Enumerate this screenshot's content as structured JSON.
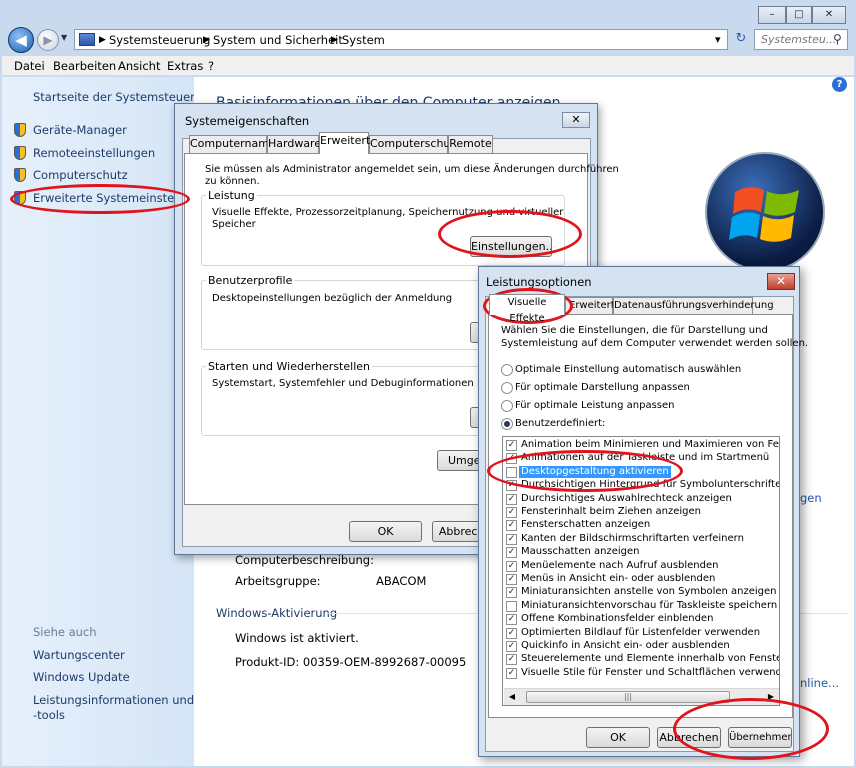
{
  "window": {
    "buttons": [
      "–",
      "□",
      "✕"
    ]
  },
  "nav": {
    "back": "◀",
    "forward": "▶",
    "dropdown": "▼",
    "breadcrumbs": [
      "Systemsteuerung",
      "System und Sicherheit",
      "System"
    ],
    "sep": "▶",
    "addr_dropdown": "▾",
    "refresh": "↻",
    "search_placeholder": "Systemsteu...",
    "search_icon": "⚲"
  },
  "menubar": [
    "Datei",
    "Bearbeiten",
    "Ansicht",
    "Extras",
    "?"
  ],
  "left_pane": {
    "home": "Startseite der Systemsteuerung",
    "items": [
      "Geräte-Manager",
      "Remoteeinstellungen",
      "Computerschutz",
      "Erweiterte Systemeinstellungen"
    ],
    "see_also_title": "Siehe auch",
    "see_also": [
      "Wartungscenter",
      "Windows Update",
      "Leistungsinformationen und",
      "-tools"
    ]
  },
  "main": {
    "header_partial": "Basisinformationen über den Computer anzeigen",
    "help": "?",
    "desc_label": "Computerbeschreibung:",
    "workgroup_label": "Arbeitsgruppe:",
    "workgroup_value": "ABACOM",
    "activation_title": "Windows-Aktivierung",
    "activation_status": "Windows ist aktiviert.",
    "product_id": "Produkt-ID: 00359-OEM-8992687-00095",
    "right_link1": "gen",
    "right_link2": "nline..."
  },
  "dialog1": {
    "title": "Systemeigenschaften",
    "close": "✕",
    "tabs": [
      "Computername",
      "Hardware",
      "Erweitert",
      "Computerschutz",
      "Remote"
    ],
    "admin_note_1": "Sie müssen als Administrator angemeldet sein, um diese Änderungen durchführen",
    "admin_note_2": "zu können.",
    "perf_title": "Leistung",
    "perf_text_1": "Visuelle Effekte, Prozessorzeitplanung, Speichernutzung und virtueller",
    "perf_text_2": "Speicher",
    "settings_btn": "Einstellungen...",
    "profiles_title": "Benutzerprofile",
    "profiles_text": "Desktopeinstellungen bezüglich der Anmeldung",
    "startup_title": "Starten und Wiederherstellen",
    "startup_text": "Systemstart, Systemfehler und Debuginformationen",
    "env_btn": "Umgebungsvariablen...",
    "ok": "OK",
    "cancel": "Abbrechen"
  },
  "dialog2": {
    "title": "Leistungsoptionen",
    "close": "✕",
    "tabs": [
      "Visuelle Effekte",
      "Erweitert",
      "Datenausführungsverhinderung"
    ],
    "intro_1": "Wählen Sie die Einstellungen, die für Darstellung und",
    "intro_2": "Systemleistung auf dem Computer verwendet werden sollen.",
    "radios": [
      {
        "label": "Optimale Einstellung automatisch auswählen",
        "selected": false
      },
      {
        "label": "Für optimale Darstellung anpassen",
        "selected": false
      },
      {
        "label": "Für optimale Leistung anpassen",
        "selected": false
      },
      {
        "label": "Benutzerdefiniert:",
        "selected": true
      }
    ],
    "checkmark": "✓",
    "options": [
      {
        "label": "Animation beim Minimieren und Maximieren von Fenstern",
        "checked": true
      },
      {
        "label": "Animationen auf der Taskleiste und im Startmenü",
        "checked": true
      },
      {
        "label": "Desktopgestaltung aktivieren",
        "checked": false,
        "highlighted": true
      },
      {
        "label": "Durchsichtigen Hintergrund für Symbolunterschriften auf dem Desktop",
        "checked": true
      },
      {
        "label": "Durchsichtiges Auswahlrechteck anzeigen",
        "checked": true
      },
      {
        "label": "Fensterinhalt beim Ziehen anzeigen",
        "checked": true
      },
      {
        "label": "Fensterschatten anzeigen",
        "checked": true
      },
      {
        "label": "Kanten der Bildschirmschriftarten verfeinern",
        "checked": true
      },
      {
        "label": "Mausschatten anzeigen",
        "checked": true
      },
      {
        "label": "Menüelemente nach Aufruf ausblenden",
        "checked": true
      },
      {
        "label": "Menüs in Ansicht ein- oder ausblenden",
        "checked": true
      },
      {
        "label": "Miniaturansichten anstelle von Symbolen anzeigen",
        "checked": true
      },
      {
        "label": "Miniaturansichtenvorschau für Taskleiste speichern",
        "checked": false
      },
      {
        "label": "Offene Kombinationsfelder einblenden",
        "checked": true
      },
      {
        "label": "Optimierten Bildlauf für Listenfelder verwenden",
        "checked": true
      },
      {
        "label": "Quickinfo in Ansicht ein- oder ausblenden",
        "checked": true
      },
      {
        "label": "Steuerelemente und Elemente innerhalb von Fenstern animieren",
        "checked": true
      },
      {
        "label": "Visuelle Stile für Fenster und Schaltflächen verwenden",
        "checked": true
      }
    ],
    "scroll_thumb": "|||",
    "ok": "OK",
    "cancel": "Abbrechen",
    "apply": "Übernehmen"
  },
  "colors": {
    "annotation": "#e0141c",
    "link": "#1e3a6a",
    "selection": "#3399ff"
  }
}
